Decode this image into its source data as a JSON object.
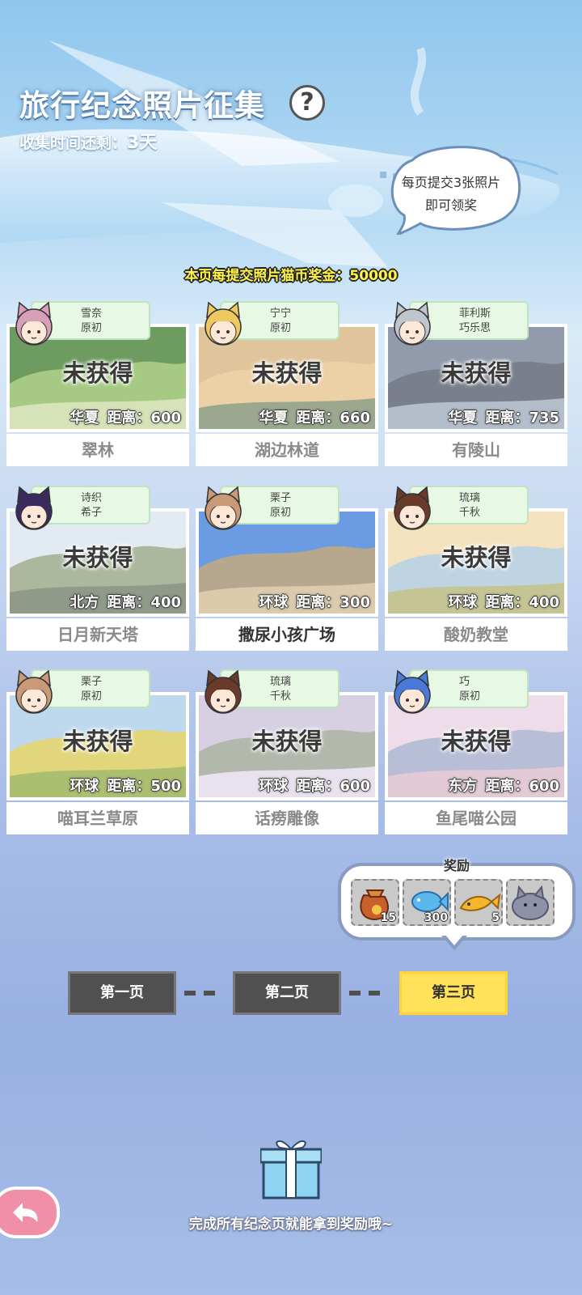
{
  "header": {
    "title": "旅行纪念照片征集",
    "help_symbol": "?",
    "remaining_label": "收集时间还剩：",
    "remaining_value": "3天"
  },
  "bubble": {
    "line1": "每页提交3张照片",
    "line2": "即可领奖"
  },
  "bonus_text": "本页每提交照片猫币奖金：50000",
  "cards": [
    {
      "char1": "雪奈",
      "char2": "原初",
      "status": "未获得",
      "region": "华夏",
      "distance": "距离：600",
      "name": "翠林"
    },
    {
      "char1": "宁宁",
      "char2": "原初",
      "status": "未获得",
      "region": "华夏",
      "distance": "距离：660",
      "name": "湖边林道"
    },
    {
      "char1": "菲利斯",
      "char2": "巧乐思",
      "status": "未获得",
      "region": "华夏",
      "distance": "距离：735",
      "name": "有陵山"
    },
    {
      "char1": "诗织",
      "char2": "希子",
      "status": "未获得",
      "region": "北方",
      "distance": "距离：400",
      "name": "日月新天塔"
    },
    {
      "char1": "栗子",
      "char2": "原初",
      "status": "",
      "region": "环球",
      "distance": "距离：300",
      "name": "撒尿小孩广场"
    },
    {
      "char1": "琉璃",
      "char2": "千秋",
      "status": "未获得",
      "region": "环球",
      "distance": "距离：400",
      "name": "酸奶教堂"
    },
    {
      "char1": "栗子",
      "char2": "原初",
      "status": "未获得",
      "region": "环球",
      "distance": "距离：500",
      "name": "喵耳兰草原"
    },
    {
      "char1": "琉璃",
      "char2": "千秋",
      "status": "未获得",
      "region": "环球",
      "distance": "距离：600",
      "name": "话痨雕像"
    },
    {
      "char1": "巧",
      "char2": "原初",
      "status": "未获得",
      "region": "东方",
      "distance": "距离：600",
      "name": "鱼尾喵公园"
    }
  ],
  "reward": {
    "title": "奖励",
    "items": [
      {
        "icon": "coin-bag-icon",
        "count": "15"
      },
      {
        "icon": "blue-fish-icon",
        "count": "300"
      },
      {
        "icon": "golden-fish-icon",
        "count": "5"
      },
      {
        "icon": "gray-cat-icon",
        "count": ""
      }
    ]
  },
  "pages": [
    "第一页",
    "第二页",
    "第三页"
  ],
  "active_page": 3,
  "footer": "完成所有纪念页就能拿到奖励哦~",
  "colors": {
    "accent_yellow": "#ffe15a",
    "tag_green": "#e7f9e5",
    "button_dark": "#505050",
    "back_pink": "#f08fa8"
  }
}
